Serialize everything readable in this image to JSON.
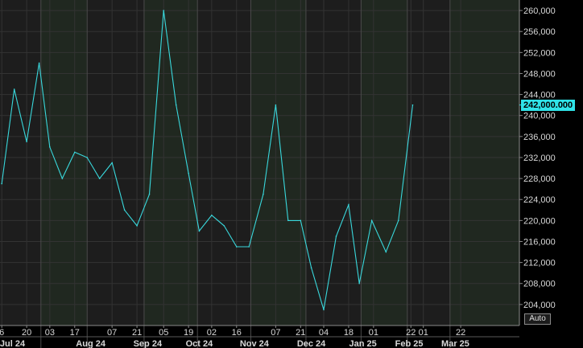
{
  "colors": {
    "background": "#000000",
    "plot_bg_a": "#1d1d1d",
    "plot_bg_b": "#202820",
    "grid": "#333333",
    "line": "#39d8dc",
    "axis_text": "#d8d8d8",
    "tag_bg": "#2fe3e8"
  },
  "controls": {
    "scale_mode": "Auto"
  },
  "chart_data": {
    "type": "line",
    "title": "",
    "xlabel": "",
    "ylabel": "",
    "ylim": [
      200000,
      262000
    ],
    "y_ticks": [
      204000,
      208000,
      212000,
      216000,
      220000,
      224000,
      228000,
      232000,
      236000,
      240000,
      244000,
      248000,
      252000,
      256000,
      260000
    ],
    "y_tick_labels": [
      "204,000",
      "208,000",
      "212,000",
      "216,000",
      "220,000",
      "224,000",
      "228,000",
      "232,000",
      "236,000",
      "240,000",
      "244,000",
      "248,000",
      "252,000",
      "256,000",
      "260,000"
    ],
    "last_value": 242000,
    "last_value_label": "242,000.000",
    "xlim": [
      "2024-06-05",
      "2025-03-24"
    ],
    "day_ticks": [
      {
        "label": "6",
        "date": "2024-06-06"
      },
      {
        "label": "20",
        "date": "2024-06-20"
      },
      {
        "label": "03",
        "date": "2024-07-03"
      },
      {
        "label": "17",
        "date": "2024-07-17"
      },
      {
        "label": "07",
        "date": "2024-08-07"
      },
      {
        "label": "21",
        "date": "2024-08-21"
      },
      {
        "label": "05",
        "date": "2024-09-05"
      },
      {
        "label": "19",
        "date": "2024-09-19"
      },
      {
        "label": "02",
        "date": "2024-10-02"
      },
      {
        "label": "16",
        "date": "2024-10-16"
      },
      {
        "label": "07",
        "date": "2024-11-07"
      },
      {
        "label": "21",
        "date": "2024-11-21"
      },
      {
        "label": "04",
        "date": "2024-12-04"
      },
      {
        "label": "18",
        "date": "2024-12-18"
      },
      {
        "label": "01",
        "date": "2025-01-01"
      },
      {
        "label": "22",
        "date": "2025-01-22"
      },
      {
        "label": "01",
        "date": "2025-01-29"
      },
      {
        "label": "22",
        "date": "2025-02-19"
      }
    ],
    "month_labels": [
      {
        "label": "Jul 24",
        "date": "2024-06-12"
      },
      {
        "label": "Aug 24",
        "date": "2024-07-26"
      },
      {
        "label": "Sep 24",
        "date": "2024-08-27"
      },
      {
        "label": "Oct 24",
        "date": "2024-09-25"
      },
      {
        "label": "Nov 24",
        "date": "2024-10-26"
      },
      {
        "label": "Dec 24",
        "date": "2024-11-27"
      },
      {
        "label": "Jan 25",
        "date": "2024-12-26"
      },
      {
        "label": "Feb 25",
        "date": "2025-01-21"
      },
      {
        "label": "Mar 25",
        "date": "2025-02-16"
      }
    ],
    "month_separators": [
      "2024-06-28",
      "2024-07-24",
      "2024-08-25",
      "2024-09-24",
      "2024-10-24",
      "2024-11-24",
      "2024-12-25",
      "2025-01-20",
      "2025-02-13"
    ],
    "shaded_bands": [
      [
        "2024-06-28",
        "2024-07-24"
      ],
      [
        "2024-08-25",
        "2024-09-24"
      ],
      [
        "2024-10-24",
        "2024-11-24"
      ],
      [
        "2024-12-25",
        "2025-01-20"
      ],
      [
        "2025-02-13",
        "2025-03-24"
      ]
    ],
    "series": [
      {
        "x": [
          "2024-06-06",
          "2024-06-13",
          "2024-06-20",
          "2024-06-27",
          "2024-07-03",
          "2024-07-10",
          "2024-07-17",
          "2024-07-24",
          "2024-07-31",
          "2024-08-07",
          "2024-08-14",
          "2024-08-21",
          "2024-08-28",
          "2024-09-05",
          "2024-09-12",
          "2024-09-19",
          "2024-09-25",
          "2024-10-02",
          "2024-10-09",
          "2024-10-16",
          "2024-10-23",
          "2024-10-31",
          "2024-11-07",
          "2024-11-14",
          "2024-11-21",
          "2024-11-27",
          "2024-12-04",
          "2024-12-11",
          "2024-12-18",
          "2024-12-24",
          "2024-12-31",
          "2025-01-08",
          "2025-01-15",
          "2025-01-23"
        ],
        "values": [
          227000,
          245000,
          235000,
          250000,
          234000,
          228000,
          233000,
          232000,
          228000,
          231000,
          222000,
          219000,
          225000,
          260000,
          242000,
          229000,
          218000,
          221000,
          219000,
          215000,
          215000,
          225000,
          242000,
          220000,
          220000,
          211000,
          203000,
          217000,
          223000,
          208000,
          220000,
          214000,
          220000,
          242000
        ]
      }
    ]
  }
}
